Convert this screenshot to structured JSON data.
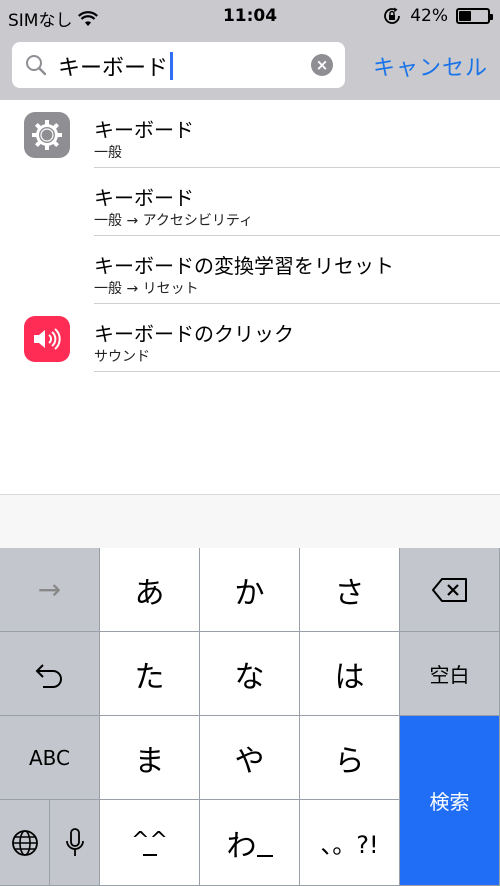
{
  "status_bar": {
    "carrier": "SIMなし",
    "time": "11:04",
    "battery_percent": "42%",
    "battery_level": 0.42
  },
  "search": {
    "query": "キーボード",
    "cancel_label": "キャンセル"
  },
  "results": [
    {
      "title": "キーボード",
      "subtitle": "一般",
      "icon": "settings-gear-icon"
    },
    {
      "title": "キーボード",
      "subtitle": "一般 → アクセシビリティ",
      "icon": ""
    },
    {
      "title": "キーボードの変換学習をリセット",
      "subtitle": "一般 → リセット",
      "icon": ""
    },
    {
      "title": "キーボードのクリック",
      "subtitle": "サウンド",
      "icon": "speaker-icon"
    }
  ],
  "keyboard": {
    "next_label": "→",
    "a": "あ",
    "ka": "か",
    "sa": "さ",
    "ta": "た",
    "na": "な",
    "ha": "は",
    "ma": "ま",
    "ya": "や",
    "ra": "ら",
    "emoticon": "^^",
    "wa": "わ",
    "punct": "、。?!",
    "space_label": "空白",
    "abc_label": "ABC",
    "search_label": "検索"
  },
  "colors": {
    "accent": "#1a73e8",
    "search_key": "#1f6ef5",
    "settings_icon_bg": "#8e8e93",
    "sound_icon_bg": "#ff2d55"
  }
}
